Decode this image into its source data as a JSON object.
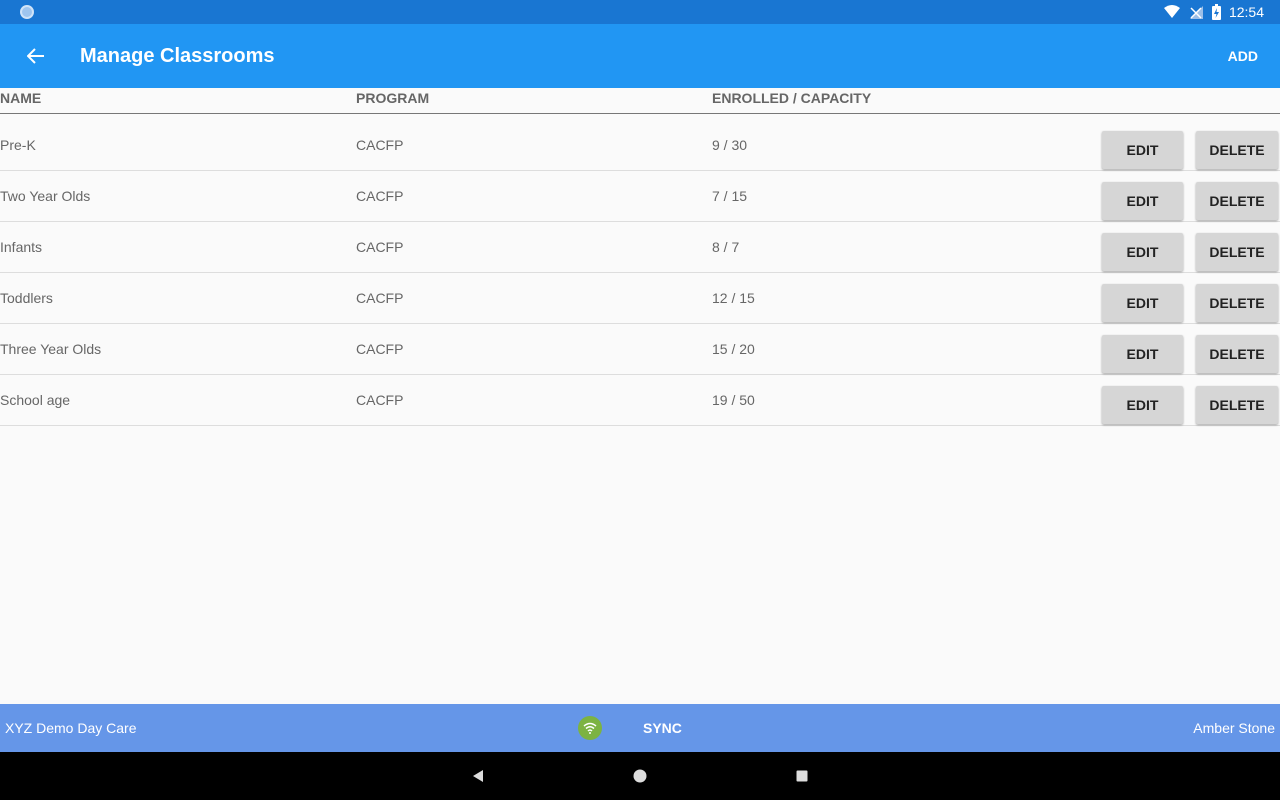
{
  "status_bar": {
    "time": "12:54"
  },
  "app_bar": {
    "title": "Manage Classrooms",
    "add_label": "ADD"
  },
  "table": {
    "headers": {
      "name": "NAME",
      "program": "PROGRAM",
      "enrolled": "ENROLLED / CAPACITY"
    },
    "rows": [
      {
        "name": "Pre-K",
        "program": "CACFP",
        "enrolled": "9 / 30",
        "edit": "EDIT",
        "delete": "DELETE"
      },
      {
        "name": "Two Year Olds",
        "program": "CACFP",
        "enrolled": "7 / 15",
        "edit": "EDIT",
        "delete": "DELETE"
      },
      {
        "name": "Infants",
        "program": "CACFP",
        "enrolled": "8 / 7",
        "edit": "EDIT",
        "delete": "DELETE"
      },
      {
        "name": "Toddlers",
        "program": "CACFP",
        "enrolled": "12 / 15",
        "edit": "EDIT",
        "delete": "DELETE"
      },
      {
        "name": "Three Year Olds",
        "program": "CACFP",
        "enrolled": "15 / 20",
        "edit": "EDIT",
        "delete": "DELETE"
      },
      {
        "name": "School age",
        "program": "CACFP",
        "enrolled": "19 / 50",
        "edit": "EDIT",
        "delete": "DELETE"
      }
    ]
  },
  "bottom_bar": {
    "org_name": "XYZ Demo Day Care",
    "sync_label": "SYNC",
    "user_name": "Amber Stone"
  },
  "colors": {
    "status_bar": "#1976d2",
    "app_bar": "#2196f3",
    "bottom_bar": "#6596e8",
    "wifi_badge": "#7cb342"
  },
  "icons": [
    "back-arrow-icon",
    "wifi-icon",
    "signal-icon",
    "battery-icon",
    "wifi-badge-icon",
    "nav-back-icon",
    "nav-home-icon",
    "nav-recents-icon"
  ]
}
